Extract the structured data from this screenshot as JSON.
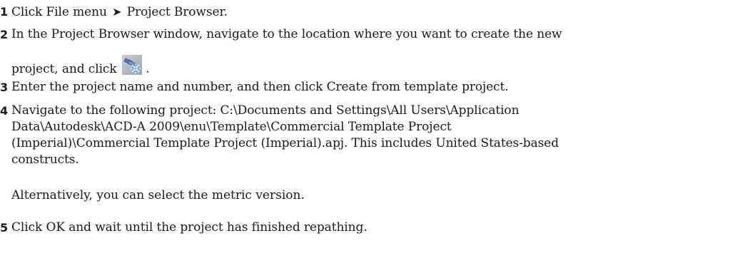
{
  "steps": [
    {
      "number": "1",
      "parts": [
        "Click File menu",
        "Project Browser."
      ]
    },
    {
      "number": "2",
      "line1": "In the Project Browser window, navigate to the location where you want to create the new",
      "line2": "project, and click",
      "line2_end": "."
    },
    {
      "number": "3",
      "text": "Enter the project name and number, and then click Create from template project."
    },
    {
      "number": "4",
      "lines": [
        "Navigate to the following project: C:\\Documents and Settings\\All Users\\Application",
        "Data\\Autodesk\\ACD-A 2009\\enu\\Template\\Commercial Template Project",
        "(Imperial)\\Commercial Template Project (Imperial).apj. This includes United States-based",
        "constructs."
      ],
      "note": "Alternatively, you can select the metric version."
    },
    {
      "number": "5",
      "text": "Click OK and wait until the project has finished repathing."
    }
  ],
  "icons": {
    "new_project": "new-project-icon"
  }
}
